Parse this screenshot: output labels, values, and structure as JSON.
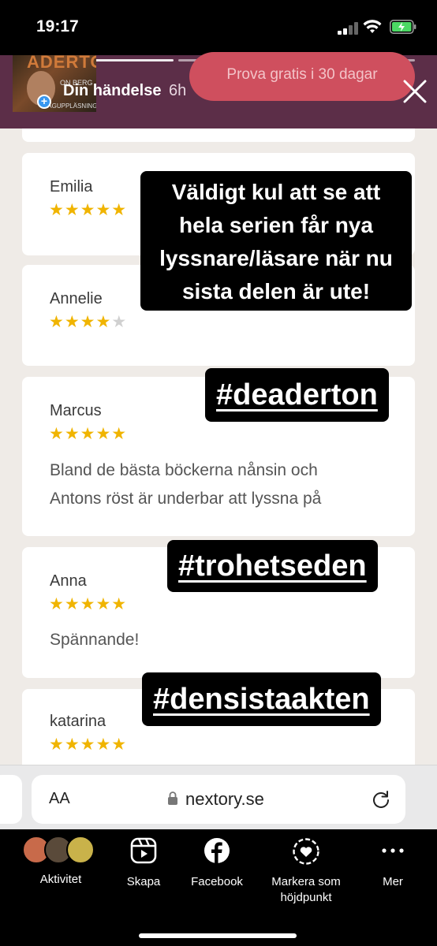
{
  "status_bar": {
    "time": "19:17"
  },
  "story": {
    "username": "Din händelse",
    "time_ago": "6h",
    "thumbnail_title": "ADERTON",
    "thumbnail_author": "ON BERG",
    "thumbnail_subtitle": "TAGUPPLÄSNING",
    "cta_button": "Prova gratis i 30 dagar",
    "caption_lines": [
      "Väldigt kul att se att",
      "hela serien får nya",
      "lyssnare/läsare när nu",
      "sista delen är ute!"
    ],
    "hashtags": [
      "#deaderton",
      "#trohetseden",
      "#densistaakten"
    ]
  },
  "reviews": [
    {
      "name": "Emilia",
      "rating": 5,
      "text": ""
    },
    {
      "name": "Annelie",
      "rating": 4,
      "text": ""
    },
    {
      "name": "Marcus",
      "rating": 5,
      "text_lines": [
        "Bland de bästa böckerna nånsin och",
        "Antons röst är underbar att lyssna på"
      ]
    },
    {
      "name": "Anna",
      "rating": 5,
      "text_lines": [
        "Spännande!"
      ]
    },
    {
      "name": "katarina",
      "rating": 5,
      "text": ""
    }
  ],
  "stars": {
    "full": "★★★★★",
    "four": "★★★★",
    "empty_one": "★"
  },
  "browser": {
    "text_size_label": "AA",
    "url": "nextory.se"
  },
  "bottom_bar": {
    "items": [
      {
        "label": "Aktivitet"
      },
      {
        "label": "Skapa"
      },
      {
        "label": "Facebook"
      },
      {
        "label_line1": "Markera som",
        "label_line2": "höjdpunkt"
      },
      {
        "label": "Mer"
      }
    ]
  },
  "colors": {
    "story_header": "#5c2e48",
    "cta": "#cf4f5e",
    "star": "#f0b400",
    "page_bg": "#efebe7"
  }
}
